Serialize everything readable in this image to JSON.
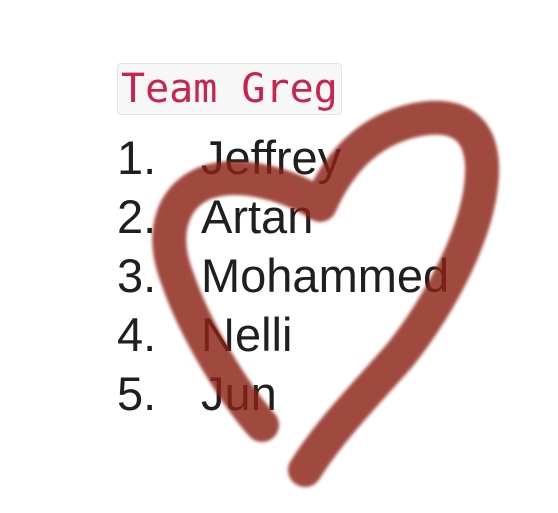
{
  "code_title": "Team Greg",
  "members": [
    {
      "number": "1.",
      "name": "Jeffrey"
    },
    {
      "number": "2.",
      "name": "Artan"
    },
    {
      "number": "3.",
      "name": "Mohammed"
    },
    {
      "number": "4.",
      "name": "Nelli"
    },
    {
      "number": "5.",
      "name": "Jun"
    }
  ],
  "overlay": {
    "icon": "heart-icon",
    "color": "#8b2212"
  }
}
